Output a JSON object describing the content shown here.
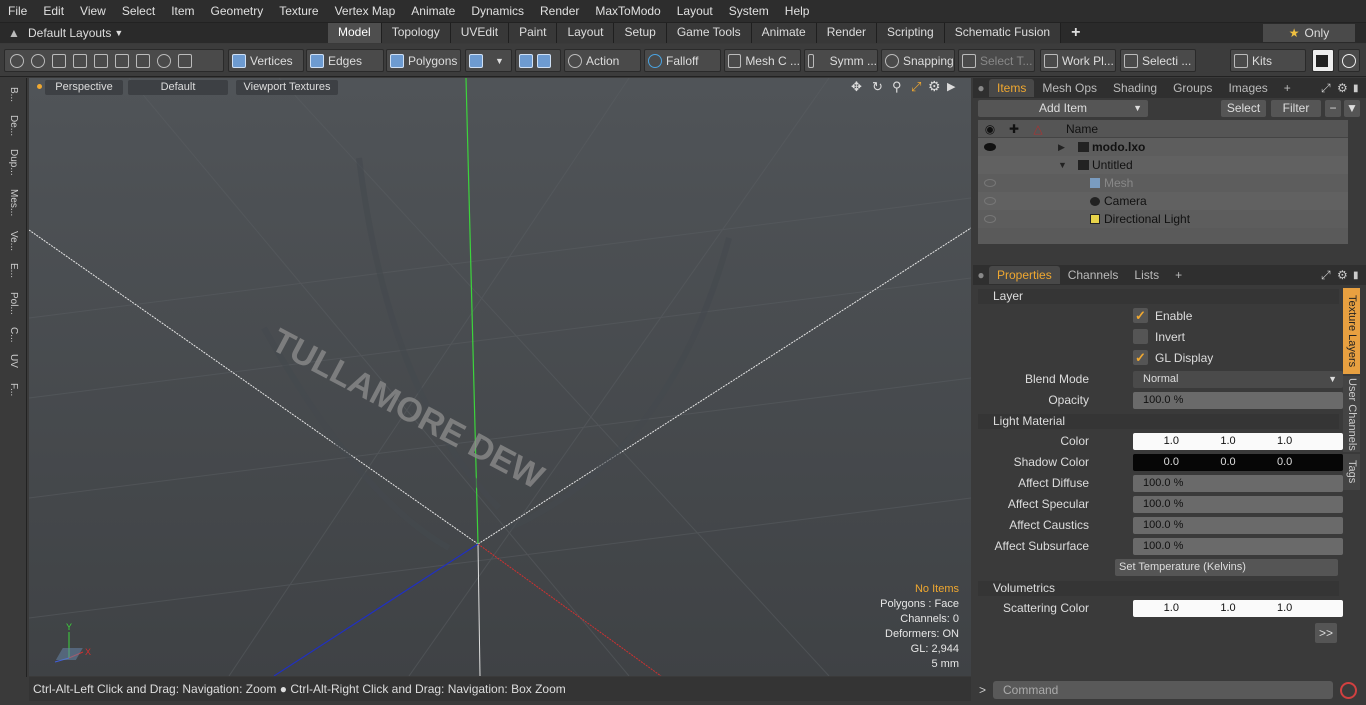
{
  "menu": [
    "File",
    "Edit",
    "View",
    "Select",
    "Item",
    "Geometry",
    "Texture",
    "Vertex Map",
    "Animate",
    "Dynamics",
    "Render",
    "MaxToModo",
    "Layout",
    "System",
    "Help"
  ],
  "layout_selector": "Default Layouts",
  "tabs": [
    {
      "label": "Model",
      "active": true
    },
    {
      "label": "Topology"
    },
    {
      "label": "UVEdit"
    },
    {
      "label": "Paint"
    },
    {
      "label": "Layout"
    },
    {
      "label": "Setup"
    },
    {
      "label": "Game Tools"
    },
    {
      "label": "Animate"
    },
    {
      "label": "Render"
    },
    {
      "label": "Scripting"
    },
    {
      "label": "Schematic Fusion"
    }
  ],
  "only_label": "Only",
  "toolbar": {
    "vertices": "Vertices",
    "edges": "Edges",
    "polygons": "Polygons",
    "action": "Action",
    "falloff": "Falloff",
    "mesh": "Mesh C ...",
    "symm": "Symm ...",
    "snapping": "Snapping",
    "select_t": "Select T...",
    "work_pl": "Work Pl...",
    "selecti": "Selecti ...",
    "kits": "Kits"
  },
  "left_tabs": [
    "B...",
    "De...",
    "Dup...",
    "Mes...",
    "Ve...",
    "E...",
    "Pol...",
    "C...",
    "UV",
    "F..."
  ],
  "viewport": {
    "perspective": "Perspective",
    "default": "Default",
    "textures": "Viewport Textures",
    "info": {
      "no_items": "No Items",
      "polygons": "Polygons : Face",
      "channels": "Channels: 0",
      "deformers": "Deformers: ON",
      "gl": "GL: 2,944",
      "mm": "5 mm"
    },
    "decal_text": "TULLAMORE DEW"
  },
  "status": "Ctrl-Alt-Left Click and Drag: Navigation: Zoom ● Ctrl-Alt-Right Click and Drag: Navigation: Box Zoom",
  "items_panel": {
    "tabs": [
      "Items",
      "Mesh Ops",
      "Shading",
      "Groups",
      "Images"
    ],
    "add_item": "Add Item",
    "select": "Select",
    "filter": "Filter",
    "col_name": "Name",
    "rows": [
      {
        "label": "modo.lxo",
        "bold": true
      },
      {
        "label": "Untitled"
      },
      {
        "label": "Mesh",
        "dim": true
      },
      {
        "label": "Camera"
      },
      {
        "label": "Directional Light"
      }
    ]
  },
  "props_panel": {
    "tabs": [
      "Properties",
      "Channels",
      "Lists"
    ],
    "layer": "Layer",
    "enable": "Enable",
    "invert": "Invert",
    "gl_display": "GL Display",
    "blend_mode_label": "Blend Mode",
    "blend_mode": "Normal",
    "opacity_label": "Opacity",
    "opacity": "100.0 %",
    "light_material": "Light Material",
    "color_label": "Color",
    "color": [
      "1.0",
      "1.0",
      "1.0"
    ],
    "shadow_label": "Shadow Color",
    "shadow": [
      "0.0",
      "0.0",
      "0.0"
    ],
    "diffuse_label": "Affect Diffuse",
    "diffuse": "100.0 %",
    "specular_label": "Affect Specular",
    "specular": "100.0 %",
    "caustics_label": "Affect Caustics",
    "caustics": "100.0 %",
    "subsurface_label": "Affect Subsurface",
    "subsurface": "100.0 %",
    "set_temp": "Set Temperature (Kelvins)",
    "volumetrics": "Volumetrics",
    "scatter_label": "Scattering Color",
    "scatter": [
      "1.0",
      "1.0",
      "1.0"
    ],
    "more": ">>"
  },
  "side_tabs": [
    "Texture Layers",
    "User Channels",
    "Tags"
  ],
  "command_placeholder": "Command"
}
